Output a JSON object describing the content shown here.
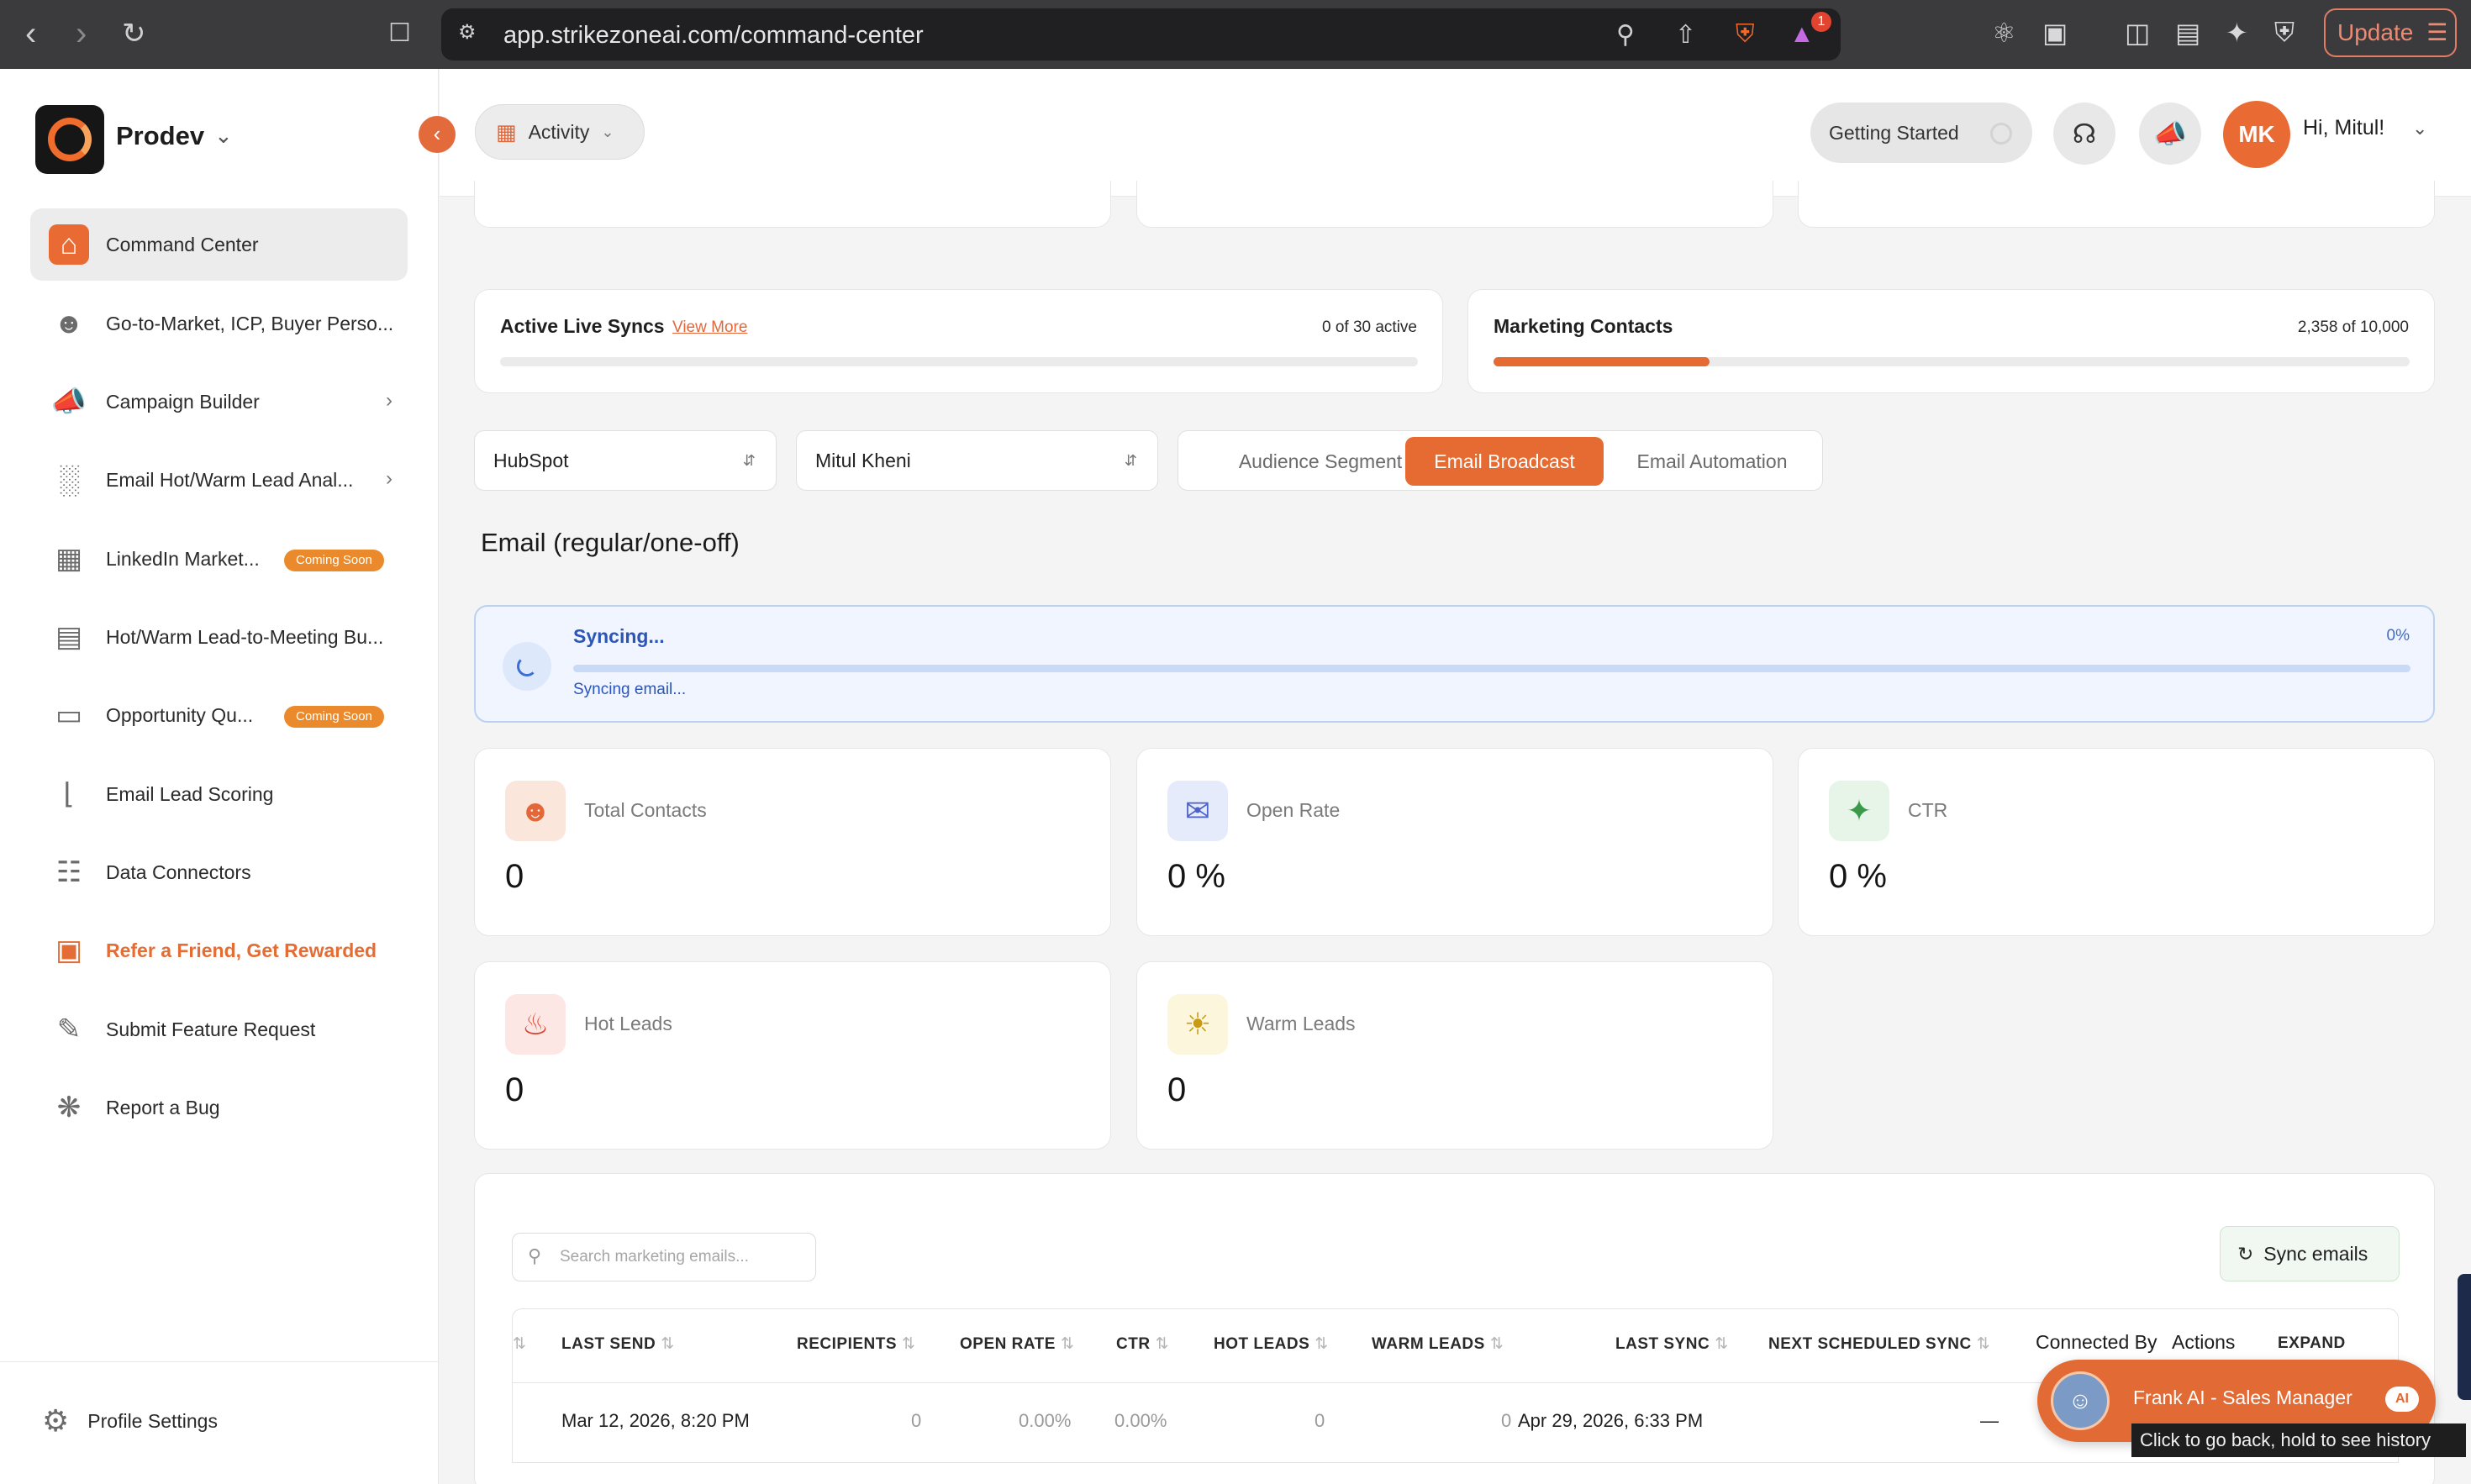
{
  "browser": {
    "url": "app.strikezoneai.com/command-center",
    "update_label": "Update",
    "notification_count": "1",
    "tooltip": "Click to go back, hold to see history"
  },
  "sidebar": {
    "org_name": "Prodev",
    "items": [
      {
        "label": "Command Center",
        "icon": "home-icon",
        "active": true
      },
      {
        "label": "Go-to-Market, ICP, Buyer Perso...",
        "icon": "users-icon"
      },
      {
        "label": "Campaign Builder",
        "icon": "megaphone-icon",
        "chevron": true
      },
      {
        "label": "Email Hot/Warm Lead Anal...",
        "icon": "bar-chart-icon",
        "chevron": true
      },
      {
        "label": "LinkedIn Market...",
        "icon": "grid-icon",
        "badge": "Coming Soon"
      },
      {
        "label": "Hot/Warm Lead-to-Meeting Bu...",
        "icon": "document-icon"
      },
      {
        "label": "Opportunity Qu...",
        "icon": "clipboard-icon",
        "badge": "Coming Soon"
      },
      {
        "label": "Email Lead Scoring",
        "icon": "thermometer-icon"
      },
      {
        "label": "Data Connectors",
        "icon": "connector-icon"
      },
      {
        "label": "Refer a Friend, Get Rewarded",
        "icon": "gift-icon"
      },
      {
        "label": "Submit Feature Request",
        "icon": "edit-icon"
      },
      {
        "label": "Report a Bug",
        "icon": "bug-icon"
      }
    ],
    "profile_settings": "Profile Settings"
  },
  "header": {
    "activity_label": "Activity",
    "getting_started": "Getting Started",
    "avatar_initials": "MK",
    "greeting": "Hi, Mitul!"
  },
  "sync_cards": {
    "live_syncs": {
      "title": "Active Live Syncs",
      "link": "View More",
      "count": "0 of 30 active",
      "progress": 0
    },
    "marketing_contacts": {
      "title": "Marketing Contacts",
      "count": "2,358 of 10,000",
      "progress": 0.2358
    }
  },
  "filters": {
    "source": "HubSpot",
    "owner": "Mitul Kheni",
    "tabs": [
      "Audience Segment",
      "Email Broadcast",
      "Email Automation"
    ],
    "active_tab": "Email Broadcast"
  },
  "section_title": "Email (regular/one-off)",
  "sync_status": {
    "title": "Syncing...",
    "percent": "0%",
    "progress": 0,
    "subtitle": "Syncing email..."
  },
  "stats": [
    {
      "label": "Total Contacts",
      "value": "0",
      "icon": "contacts-icon",
      "color": "#e2683a"
    },
    {
      "label": "Open Rate",
      "value": "0 %",
      "icon": "mail-icon",
      "color": "#4a62c9"
    },
    {
      "label": "CTR",
      "value": "0 %",
      "icon": "cursor-click-icon",
      "color": "#3a9a4a"
    },
    {
      "label": "Hot Leads",
      "value": "0",
      "icon": "flame-icon",
      "color": "#d9432f"
    },
    {
      "label": "Warm Leads",
      "value": "0",
      "icon": "sun-icon",
      "color": "#c99a12"
    }
  ],
  "table": {
    "search_placeholder": "Search marketing emails...",
    "sync_button": "Sync emails",
    "columns": [
      "LAST SEND",
      "RECIPIENTS",
      "OPEN RATE",
      "CTR",
      "HOT LEADS",
      "WARM LEADS",
      "LAST SYNC",
      "NEXT SCHEDULED SYNC",
      "Connected By",
      "Actions",
      "EXPAND"
    ],
    "rows": [
      {
        "last_send": "Mar 12, 2026, 8:20 PM",
        "recipients": "0",
        "open_rate": "0.00%",
        "ctr": "0.00%",
        "hot_leads": "0",
        "warm_leads": "0",
        "last_sync": "Apr 29, 2026, 6:33 PM",
        "next_sync": "—"
      }
    ]
  },
  "assistant": {
    "name": "Frank AI - Sales Manager",
    "badge": "AI"
  }
}
